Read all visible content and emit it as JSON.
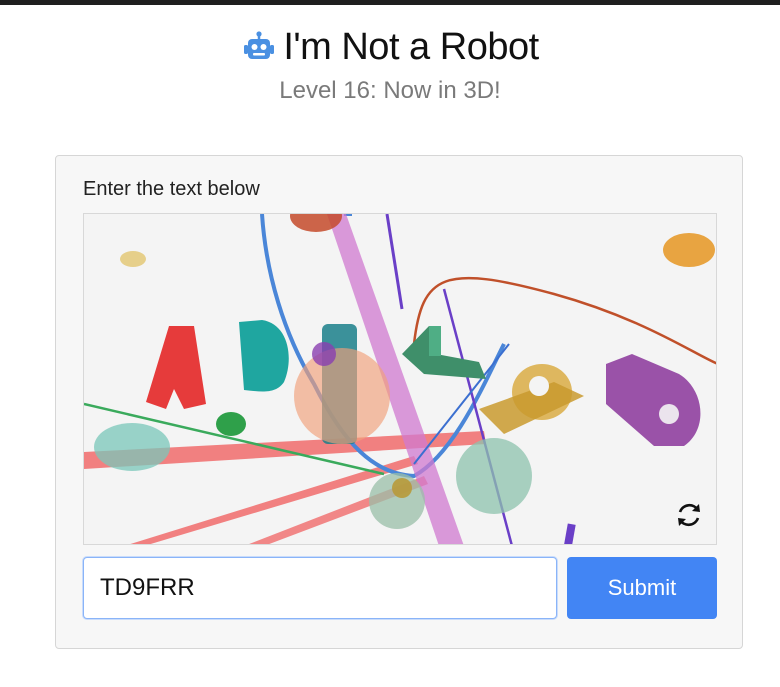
{
  "header": {
    "title": "I'm Not a Robot",
    "subtitle": "Level 16: Now in 3D!",
    "icon": "robot-icon"
  },
  "captcha": {
    "instruction": "Enter the text below",
    "refresh_icon": "refresh-icon"
  },
  "form": {
    "input_value": "TD9FRR",
    "submit_label": "Submit"
  },
  "colors": {
    "accent": "#4285f4",
    "robot_icon": "#4a90e2"
  }
}
